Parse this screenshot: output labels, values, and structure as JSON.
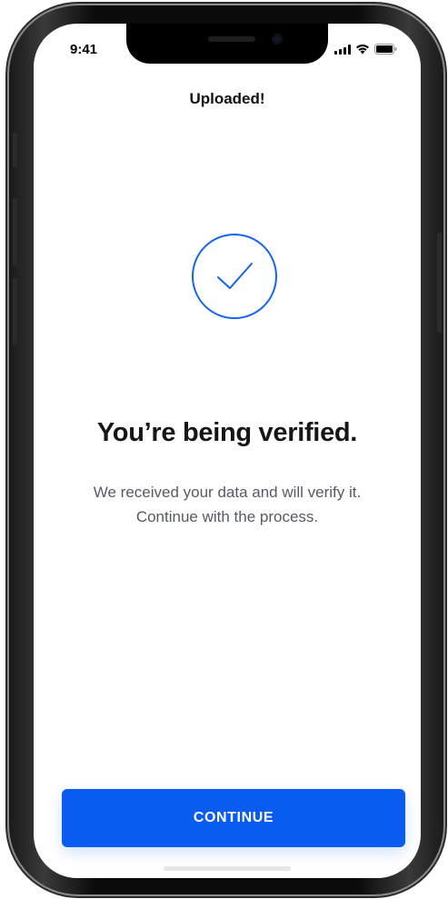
{
  "status_bar": {
    "time": "9:41",
    "icons": [
      "signal-icon",
      "wifi-icon",
      "battery-icon"
    ]
  },
  "header": {
    "title": "Uploaded!"
  },
  "main": {
    "status_icon": "check-circle-icon",
    "headline": "You’re being verified.",
    "body_line1": "We received your data and will verify it.",
    "body_line2": "Continue with the process."
  },
  "footer": {
    "continue_label": "CONTINUE"
  },
  "colors": {
    "accent": "#0A5CF0",
    "text_primary": "#14161A",
    "text_secondary": "#555A66",
    "background": "#FFFFFF"
  }
}
